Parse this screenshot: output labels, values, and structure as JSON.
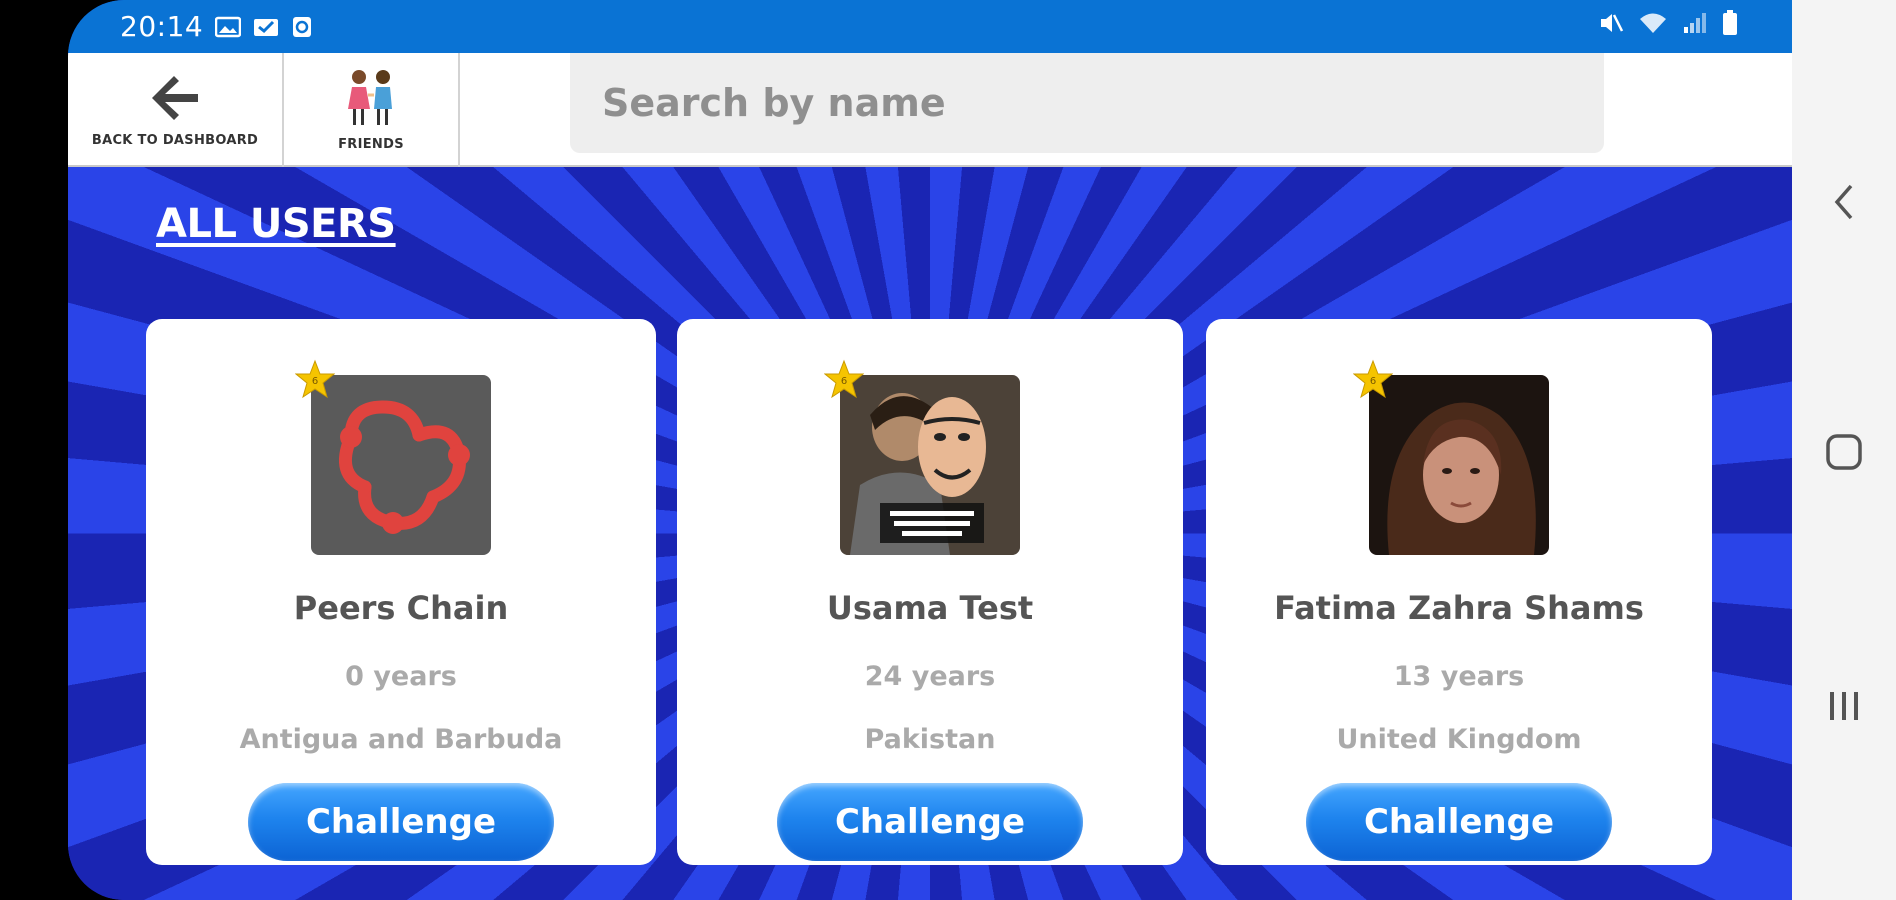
{
  "status_bar": {
    "time": "20:14"
  },
  "top_bar": {
    "back_label": "BACK TO DASHBOARD",
    "friends_label": "FRIENDS",
    "search_placeholder": "Search by name"
  },
  "section": {
    "title": "ALL USERS"
  },
  "users": [
    {
      "name": "Peers Chain",
      "age": "0 years",
      "country": "Antigua and Barbuda",
      "button": "Challenge",
      "avatar": "peers-chain-logo",
      "badge": "6"
    },
    {
      "name": "Usama Test",
      "age": "24 years",
      "country": "Pakistan",
      "button": "Challenge",
      "avatar": "masked-man-photo",
      "badge": "6"
    },
    {
      "name": "Fatima Zahra Shams",
      "age": "13 years",
      "country": "United Kingdom",
      "button": "Challenge",
      "avatar": "girl-portrait-photo",
      "badge": "6"
    }
  ],
  "colors": {
    "status_bar": "#0a73d4",
    "background_ray_light": "#2a44e8",
    "background_ray_dark": "#1a25b3",
    "button_blue": "#1e84ee",
    "star": "#f5c400"
  }
}
